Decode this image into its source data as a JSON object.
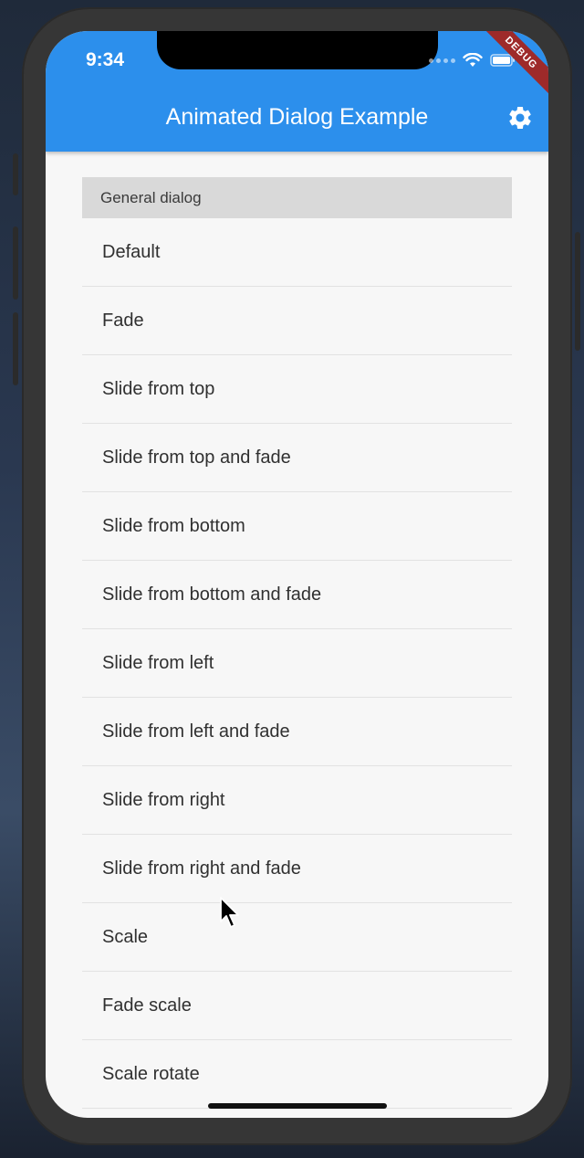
{
  "status_bar": {
    "time": "9:34"
  },
  "app_bar": {
    "title": "Animated Dialog Example",
    "debug_banner": "DEBUG"
  },
  "section": {
    "title": "General dialog"
  },
  "items": [
    "Default",
    "Fade",
    "Slide from top",
    "Slide from top and fade",
    "Slide from bottom",
    "Slide from bottom and fade",
    "Slide from left",
    "Slide from left and fade",
    "Slide from right",
    "Slide from right and fade",
    "Scale",
    "Fade scale",
    "Scale rotate"
  ],
  "icons": {
    "settings": "gear-icon",
    "wifi": "wifi-icon",
    "battery": "battery-icon",
    "cursor": "mouse-pointer-icon"
  },
  "colors": {
    "app_bar": "#2c8fec",
    "background": "#f7f7f7",
    "section_header": "#d9d9d9",
    "debug_banner": "#9e2a2a"
  }
}
